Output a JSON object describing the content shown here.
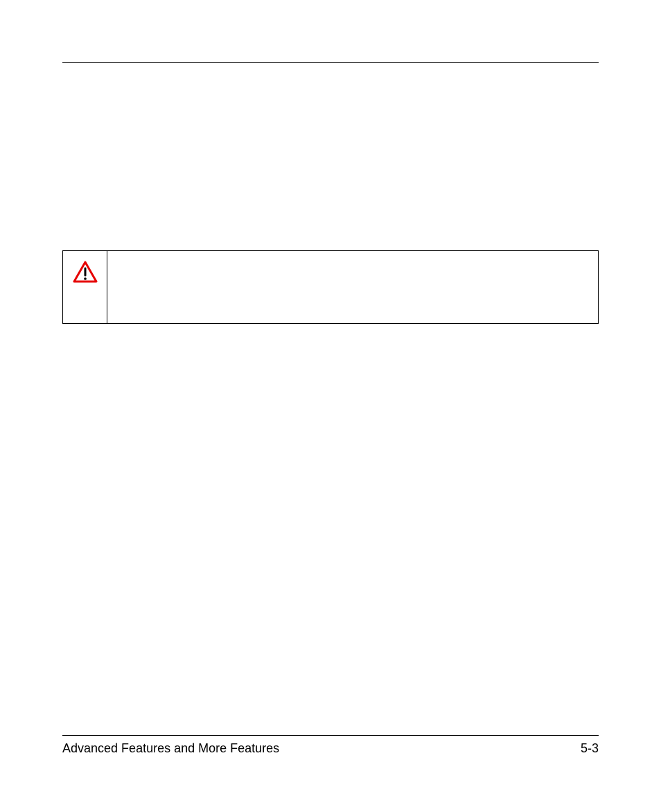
{
  "footer": {
    "left": "Advanced Features and More Features",
    "right": "5-3"
  },
  "callout": {
    "icon_name": "warning-icon"
  }
}
